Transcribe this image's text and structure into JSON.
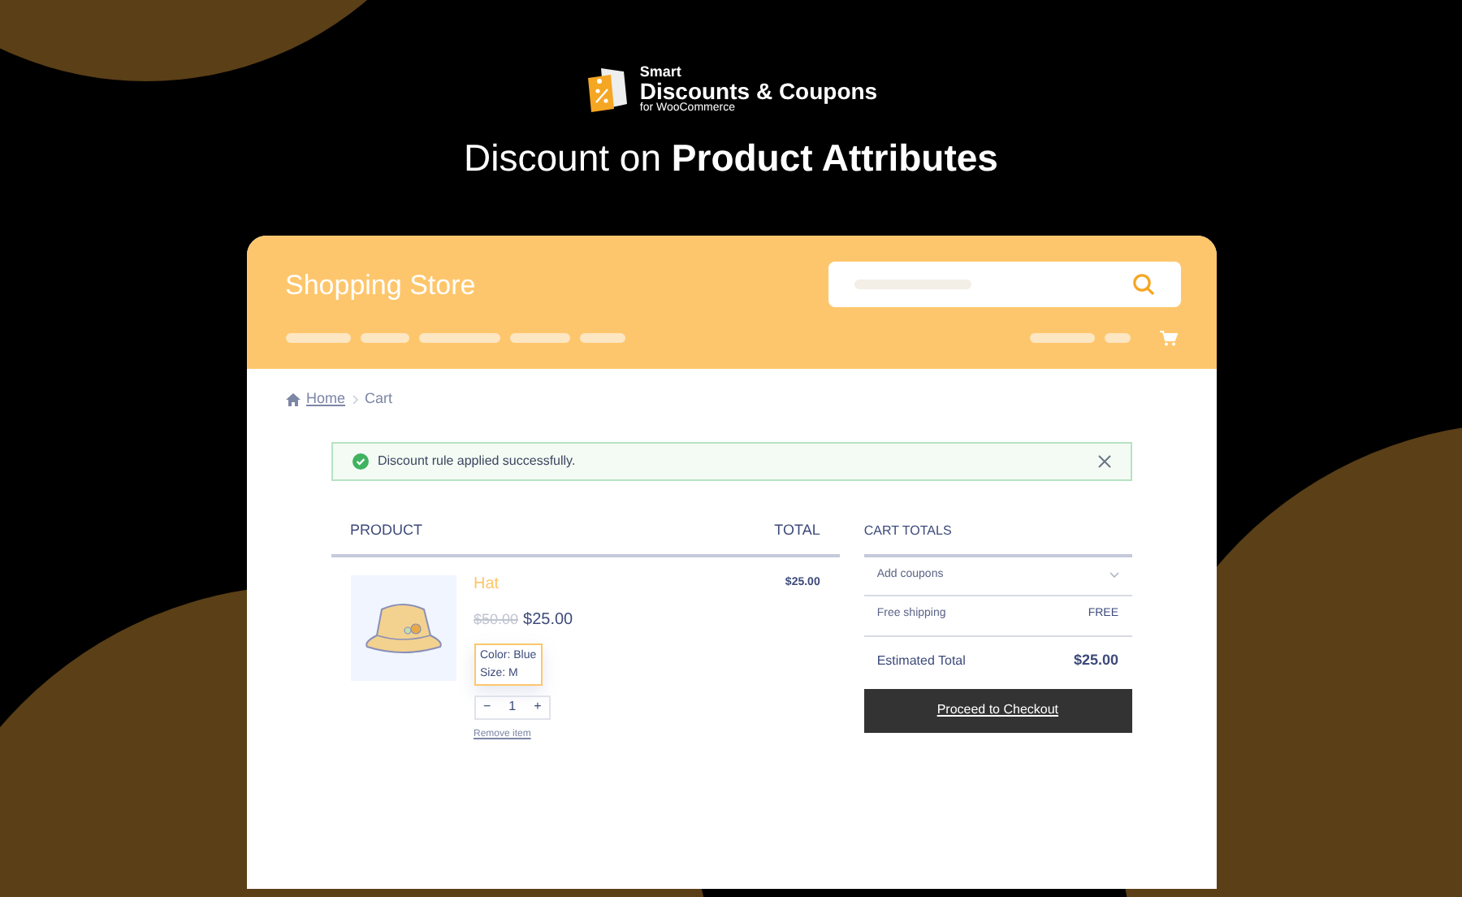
{
  "promo": {
    "logo": {
      "top": "Smart",
      "main": "Discounts & Coupons",
      "sub": "for WooCommerce"
    },
    "headline": "Discount on **Product Attributes**"
  },
  "store": {
    "title": "Shopping Store",
    "breadcrumb": [
      "Home",
      "Cart"
    ],
    "notice": {
      "text": "Discount rule applied successfully."
    },
    "cart": {
      "columns": [
        "PRODUCT",
        "TOTAL"
      ],
      "items": [
        {
          "name": "Hat",
          "old_price": "$50.00",
          "price": "$25.00",
          "attributes": [
            "Color: Blue",
            "Size: M"
          ],
          "quantity": "1",
          "minus": "−",
          "plus": "+",
          "remove": "Remove item",
          "total": "$25.00"
        }
      ]
    },
    "totals": {
      "title": "CART TOTALS",
      "coupon": "Add coupons",
      "rows": [
        {
          "label": "Free shipping",
          "value": "FREE",
          "kind": "plain"
        },
        {
          "label": "Estimated Total",
          "value": "$25.00",
          "kind": "total"
        }
      ],
      "checkout": "Proceed to Checkout"
    }
  }
}
